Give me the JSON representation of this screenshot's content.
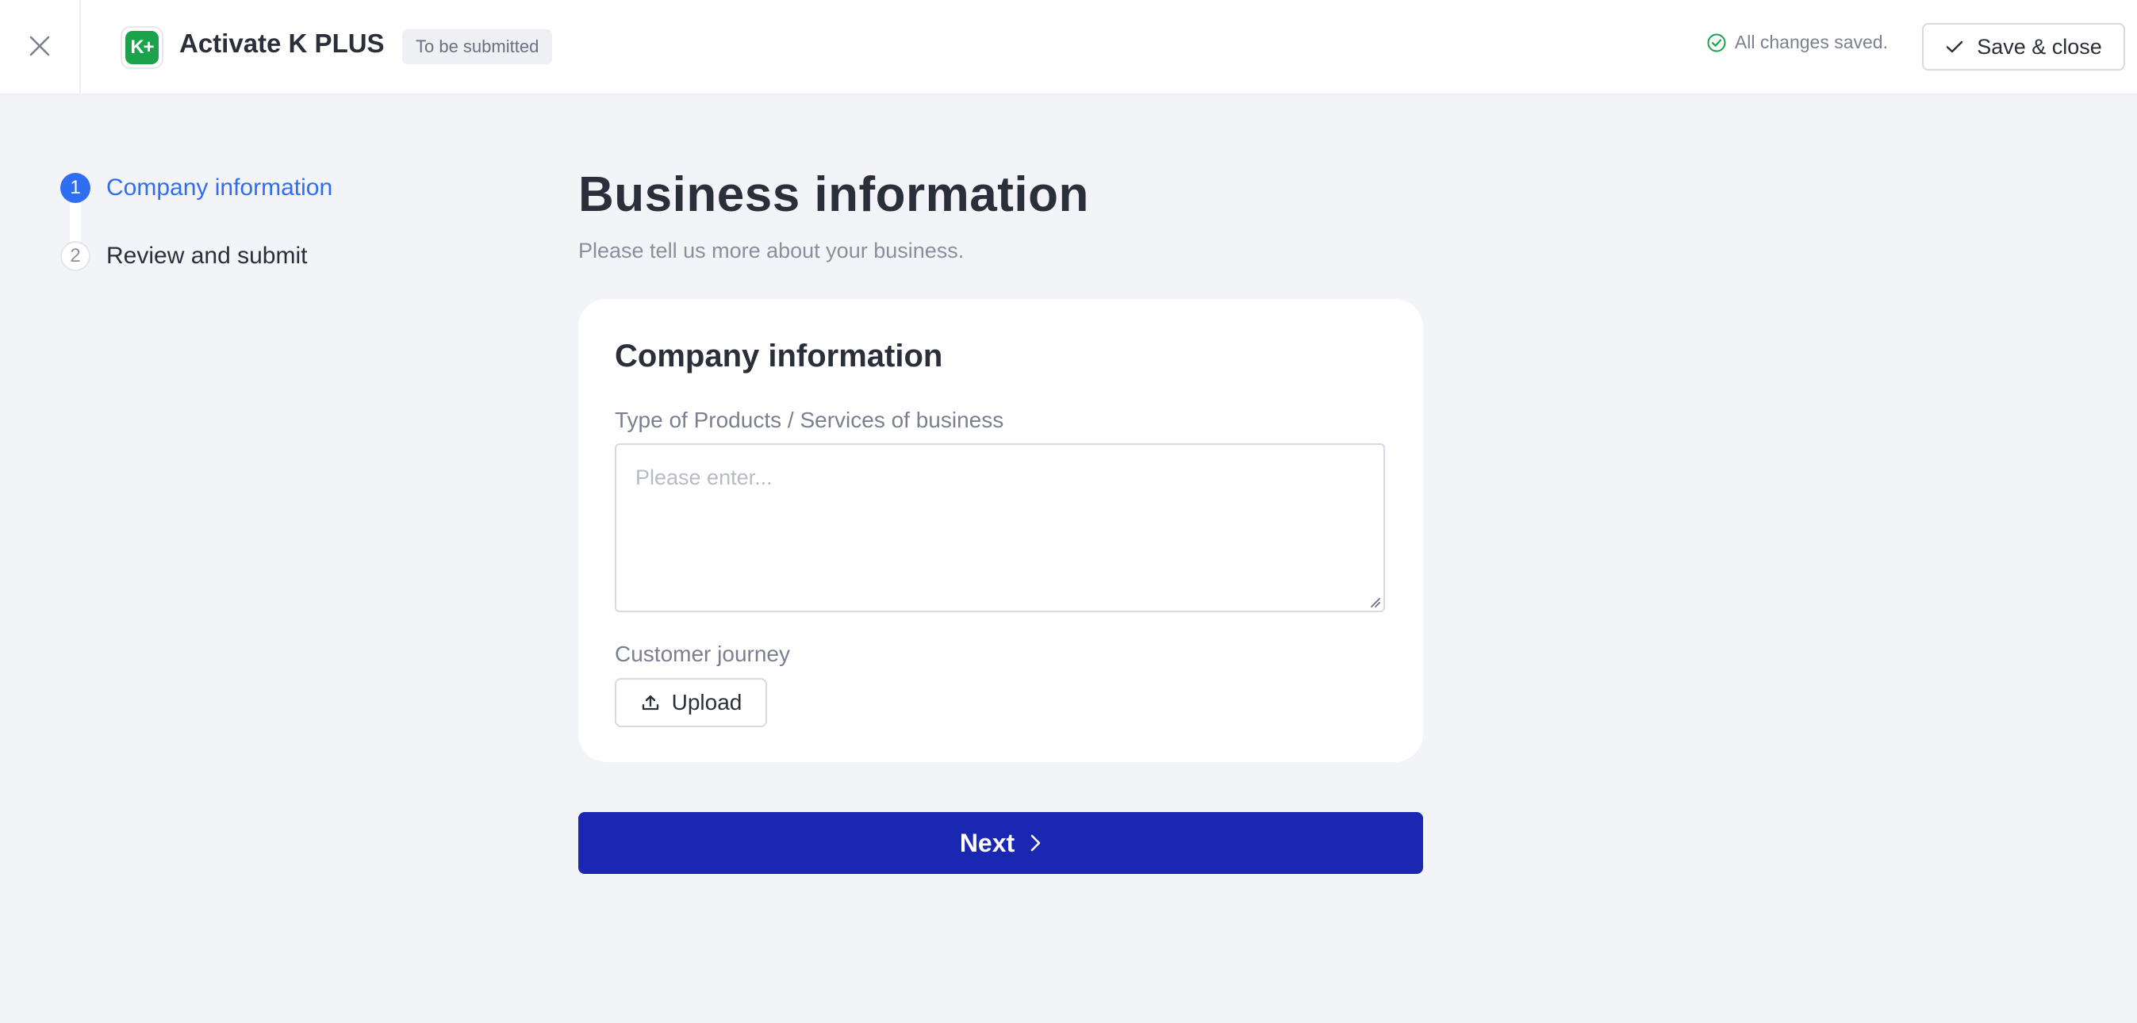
{
  "header": {
    "close_icon": "close-icon",
    "app_logo_text": "K+",
    "app_title": "Activate K PLUS",
    "status_chip": "To be submitted",
    "saved_status": "All changes saved.",
    "save_close_label": "Save & close",
    "brand_color": "#1aa34a"
  },
  "stepper": {
    "steps": [
      {
        "number": "1",
        "label": "Company information",
        "state": "active"
      },
      {
        "number": "2",
        "label": "Review and submit",
        "state": "todo"
      }
    ],
    "accent_color": "#2f6ef3"
  },
  "main": {
    "title": "Business information",
    "subtitle": "Please tell us more about your business.",
    "card": {
      "title": "Company information",
      "products_label": "Type of Products / Services of business",
      "products_placeholder": "Please enter...",
      "products_value": "",
      "journey_label": "Customer journey",
      "upload_label": "Upload"
    },
    "next_label": "Next",
    "next_color": "#1a27b3"
  }
}
